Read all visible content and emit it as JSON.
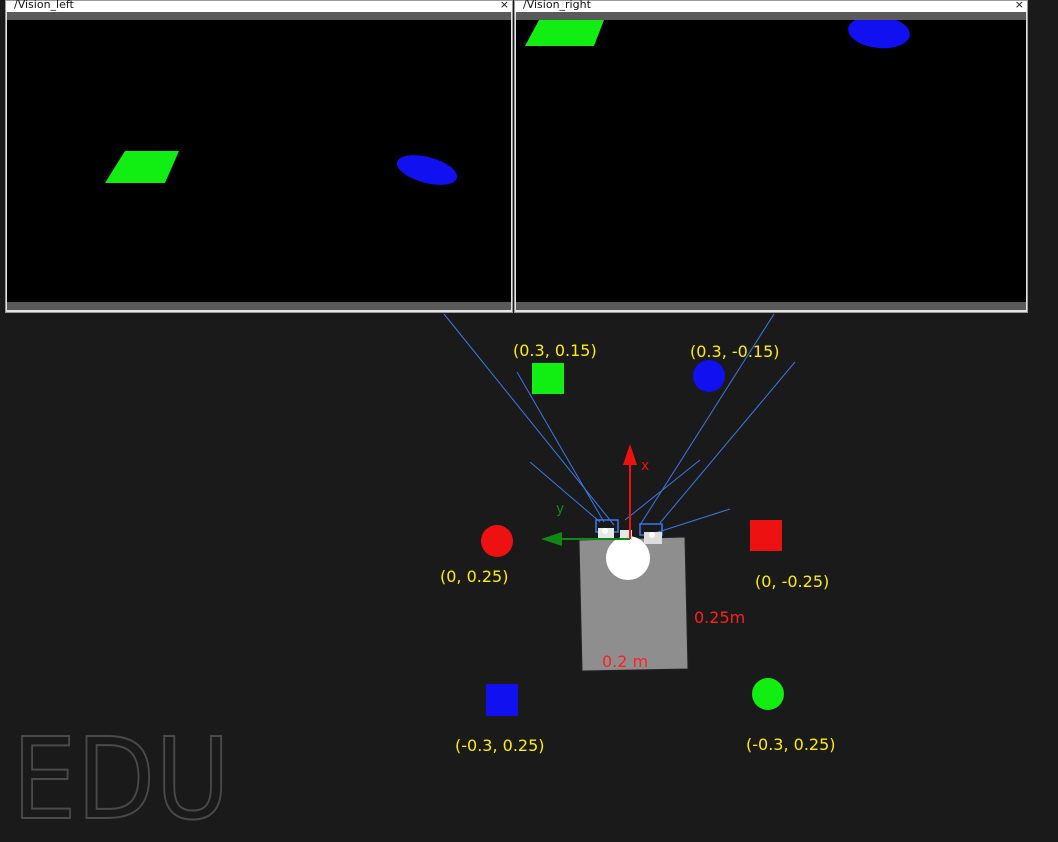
{
  "windows": {
    "left": {
      "title": "/Vision_left",
      "close": "×"
    },
    "right": {
      "title": "/Vision_right",
      "close": "×"
    }
  },
  "scene": {
    "object_labels": {
      "green_square": "(0.3, 0.15)",
      "blue_circle": "(0.3, -0.15)",
      "red_circle": "(0, 0.25)",
      "red_square": "(0, -0.25)",
      "blue_square": "(-0.3, 0.25)",
      "green_circle": "(-0.3, 0.25)"
    },
    "axis": {
      "x": "x",
      "y": "y"
    },
    "dimensions": {
      "length": "0.25m",
      "width": "0.2 m"
    },
    "watermark": "EDU"
  },
  "colors": {
    "background": "#1a1a1a",
    "label": "#ffee00",
    "dimension": "#ff2020",
    "green": "#11ee11",
    "blue": "#1010f0",
    "red": "#ee1111",
    "sensor_lines": "#3a78e6",
    "robot_body": "#8e8e8e"
  }
}
